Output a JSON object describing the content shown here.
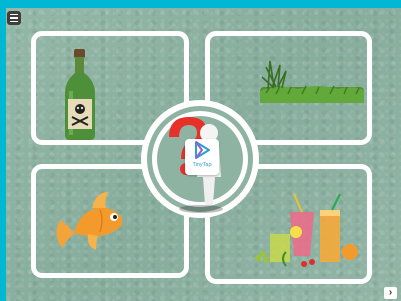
{
  "app": {
    "brand": "TinyTap"
  },
  "toolbar": {
    "menu_icon": "hamburger-menu-icon",
    "next_icon": "chevron-right-icon",
    "next_glyph": "›"
  },
  "panels": [
    {
      "id": "poison",
      "icon": "poison-bottle-icon"
    },
    {
      "id": "grass",
      "icon": "grass-icon"
    },
    {
      "id": "fish",
      "icon": "goldfish-icon"
    },
    {
      "id": "juice",
      "icon": "juice-drinks-icon"
    }
  ],
  "center": {
    "icon": "question-mark-figure-icon"
  },
  "colors": {
    "frame": "#00b8d4",
    "board": "#8fb3a3",
    "question_mark": "#e8302a",
    "brand_blue": "#2a9fd6"
  }
}
